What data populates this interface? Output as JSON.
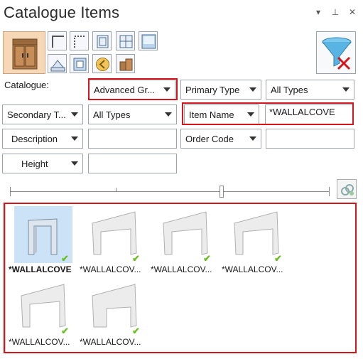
{
  "header": {
    "title": "Catalogue Items"
  },
  "window_controls": {
    "dropdown": "▾",
    "pin": "⊥",
    "close": "✕"
  },
  "filters": {
    "catalogue_label": "Catalogue:",
    "catalogue_value": "Advanced Gr...",
    "primary_type": "Primary Type",
    "primary_all_types": "All Types",
    "secondary_type": "Secondary T...",
    "secondary_all_types": "All Types",
    "item_name_field": "Item Name",
    "item_name_value": "*WALLALCOVE",
    "description_field": "Description",
    "description_value": "",
    "order_code_field": "Order Code",
    "order_code_value": "",
    "height_field": "Height",
    "height_value": ""
  },
  "results": {
    "items": [
      {
        "caption": "*WALLALCOVE",
        "selected": true
      },
      {
        "caption": "*WALLALCOV...",
        "selected": false
      },
      {
        "caption": "*WALLALCOV...",
        "selected": false
      },
      {
        "caption": "*WALLALCOV...",
        "selected": false
      },
      {
        "caption": "*WALLALCOV...",
        "selected": false
      },
      {
        "caption": "*WALLALCOV...",
        "selected": false
      }
    ]
  },
  "colors": {
    "highlight": "#d8141b",
    "selected": "#cce3f7",
    "check": "#6cbf22"
  }
}
